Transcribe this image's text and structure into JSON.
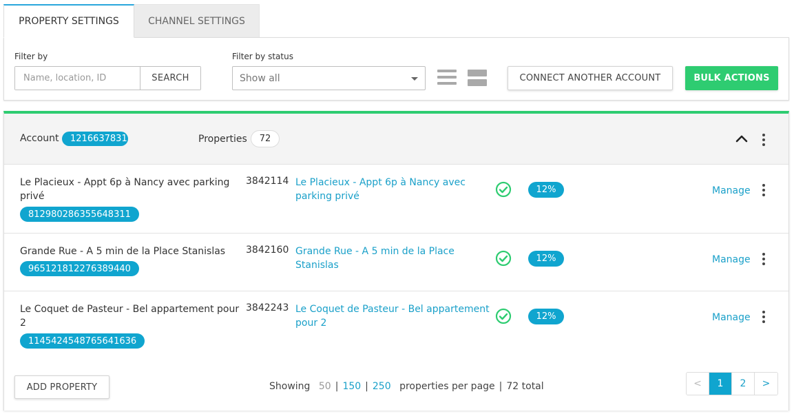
{
  "tabs": [
    {
      "label": "PROPERTY SETTINGS",
      "active": true
    },
    {
      "label": "CHANNEL SETTINGS",
      "active": false
    }
  ],
  "filters": {
    "filter_by_label": "Filter by",
    "search_placeholder": "Name, location, ID",
    "search_button": "SEARCH",
    "status_label": "Filter by status",
    "status_value": "Show all",
    "list_view_icon": "list-view-icon",
    "grid_view_icon": "grid-view-icon",
    "connect_button": "CONNECT ANOTHER ACCOUNT",
    "bulk_button": "BULK ACTIONS"
  },
  "account": {
    "label": "Account",
    "id_badge": "1216637831",
    "properties_label": "Properties",
    "properties_count": "72"
  },
  "rows": [
    {
      "name": "Le Placieux - Appt 6p à Nancy avec parking privé",
      "listing_id": "812980286355648311",
      "property_id": "3842114",
      "link": "Le Placieux - Appt 6p à Nancy avec parking privé",
      "percent": "12%",
      "manage": "Manage"
    },
    {
      "name": "Grande Rue - A 5 min de la Place Stanislas",
      "listing_id": "965121812276389440",
      "property_id": "3842160",
      "link": "Grande Rue - A 5 min de la Place Stanislas",
      "percent": "12%",
      "manage": "Manage"
    },
    {
      "name": "Le Coquet de Pasteur - Bel appartement pour 2",
      "listing_id": "1145424548765641636",
      "property_id": "3842243",
      "link": "Le Coquet de Pasteur - Bel appartement pour 2",
      "percent": "12%",
      "manage": "Manage"
    }
  ],
  "footer": {
    "add_button": "ADD PROPERTY",
    "showing_prefix": "Showing",
    "per_page_options": [
      "50",
      "150",
      "250"
    ],
    "per_page_suffix": "properties per page",
    "total": "72 total",
    "pager": [
      "<",
      "1",
      "2",
      ">"
    ]
  },
  "colors": {
    "accent_blue": "#10a5cf",
    "link_blue": "#1aa0c9",
    "success_green": "#2ecc71"
  }
}
